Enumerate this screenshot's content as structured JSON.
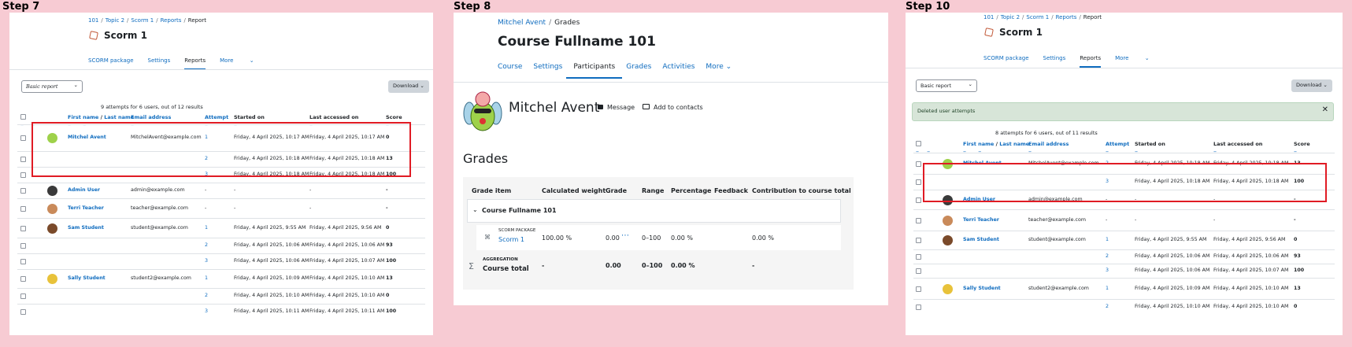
{
  "steps": [
    "Step 7",
    "Step 8",
    "Step 10"
  ],
  "scorm": {
    "breadcrumb": [
      "101",
      "Topic 2",
      "Scorm 1",
      "Reports",
      "Report"
    ],
    "title": "Scorm 1",
    "tabs": [
      "SCORM package",
      "Settings",
      "Reports",
      "More"
    ],
    "report_select": "Basic report",
    "download": "Download",
    "columns": {
      "first": "First name",
      "slash": "/",
      "last": "Last name",
      "email": "Email address",
      "attempt": "Attempt",
      "started": "Started on",
      "last_access": "Last accessed on",
      "score": "Score"
    },
    "step7": {
      "summary": "9 attempts for 6 users, out of 12 results",
      "rows": [
        {
          "name": "Mitchel Avent",
          "email": "MitchelAvent@example.com",
          "attempt": "1",
          "started": "Friday, 4 April 2025, 10:17 AM",
          "last": "Friday, 4 April 2025, 10:17 AM",
          "score": "0"
        },
        {
          "name": "",
          "email": "",
          "attempt": "2",
          "started": "Friday, 4 April 2025, 10:18 AM",
          "last": "Friday, 4 April 2025, 10:18 AM",
          "score": "13"
        },
        {
          "name": "",
          "email": "",
          "attempt": "3",
          "started": "Friday, 4 April 2025, 10:18 AM",
          "last": "Friday, 4 April 2025, 10:18 AM",
          "score": "100"
        },
        {
          "name": "Admin User",
          "email": "admin@example.com",
          "attempt": "-",
          "started": "-",
          "last": "-",
          "score": "-"
        },
        {
          "name": "Terri Teacher",
          "email": "teacher@example.com",
          "attempt": "-",
          "started": "-",
          "last": "-",
          "score": "-"
        },
        {
          "name": "Sam Student",
          "email": "student@example.com",
          "attempt": "1",
          "started": "Friday, 4 April 2025, 9:55 AM",
          "last": "Friday, 4 April 2025, 9:56 AM",
          "score": "0"
        },
        {
          "name": "",
          "email": "",
          "attempt": "2",
          "started": "Friday, 4 April 2025, 10:06 AM",
          "last": "Friday, 4 April 2025, 10:06 AM",
          "score": "93"
        },
        {
          "name": "",
          "email": "",
          "attempt": "3",
          "started": "Friday, 4 April 2025, 10:06 AM",
          "last": "Friday, 4 April 2025, 10:07 AM",
          "score": "100"
        },
        {
          "name": "Sally Student",
          "email": "student2@example.com",
          "attempt": "1",
          "started": "Friday, 4 April 2025, 10:09 AM",
          "last": "Friday, 4 April 2025, 10:10 AM",
          "score": "13"
        },
        {
          "name": "",
          "email": "",
          "attempt": "2",
          "started": "Friday, 4 April 2025, 10:10 AM",
          "last": "Friday, 4 April 2025, 10:10 AM",
          "score": "0"
        },
        {
          "name": "",
          "email": "",
          "attempt": "3",
          "started": "Friday, 4 April 2025, 10:11 AM",
          "last": "Friday, 4 April 2025, 10:11 AM",
          "score": "100"
        }
      ]
    },
    "step10": {
      "alert": "Deleted user attempts",
      "summary": "8 attempts for 6 users, out of 11 results",
      "rows": [
        {
          "name": "Mitchel Avent",
          "email": "MitchelAvent@example.com",
          "attempt": "2",
          "started": "Friday, 4 April 2025, 10:18 AM",
          "last": "Friday, 4 April 2025, 10:18 AM",
          "score": "13"
        },
        {
          "name": "",
          "email": "",
          "attempt": "3",
          "started": "Friday, 4 April 2025, 10:18 AM",
          "last": "Friday, 4 April 2025, 10:18 AM",
          "score": "100"
        },
        {
          "name": "Admin User",
          "email": "admin@example.com",
          "attempt": "-",
          "started": "-",
          "last": "-",
          "score": "-"
        },
        {
          "name": "Terri Teacher",
          "email": "teacher@example.com",
          "attempt": "-",
          "started": "-",
          "last": "-",
          "score": "-"
        },
        {
          "name": "Sam Student",
          "email": "student@example.com",
          "attempt": "1",
          "started": "Friday, 4 April 2025, 9:55 AM",
          "last": "Friday, 4 April 2025, 9:56 AM",
          "score": "0"
        },
        {
          "name": "",
          "email": "",
          "attempt": "2",
          "started": "Friday, 4 April 2025, 10:06 AM",
          "last": "Friday, 4 April 2025, 10:06 AM",
          "score": "93"
        },
        {
          "name": "",
          "email": "",
          "attempt": "3",
          "started": "Friday, 4 April 2025, 10:06 AM",
          "last": "Friday, 4 April 2025, 10:07 AM",
          "score": "100"
        },
        {
          "name": "Sally Student",
          "email": "student2@example.com",
          "attempt": "1",
          "started": "Friday, 4 April 2025, 10:09 AM",
          "last": "Friday, 4 April 2025, 10:10 AM",
          "score": "13"
        },
        {
          "name": "",
          "email": "",
          "attempt": "2",
          "started": "Friday, 4 April 2025, 10:10 AM",
          "last": "Friday, 4 April 2025, 10:10 AM",
          "score": "0"
        }
      ]
    }
  },
  "grades": {
    "breadcrumb": [
      "Mitchel Avent",
      "Grades"
    ],
    "course": "Course Fullname 101",
    "tabs": [
      "Course",
      "Settings",
      "Participants",
      "Grades",
      "Activities",
      "More"
    ],
    "user": "Mitchel Avent",
    "message": "Message",
    "contacts": "Add to contacts",
    "heading": "Grades",
    "cols": [
      "Grade item",
      "Calculated weight",
      "Grade",
      "Range",
      "Percentage",
      "Feedback",
      "Contribution to course total"
    ],
    "category": "Course Fullname 101",
    "item": {
      "type": "SCORM PACKAGE",
      "name": "Scorm 1",
      "weight": "100.00 %",
      "grade": "0.00",
      "range": "0–100",
      "pct": "0.00 %",
      "contrib": "0.00 %"
    },
    "total": {
      "type": "AGGREGATION",
      "name": "Course total",
      "weight": "-",
      "grade": "0.00",
      "range": "0–100",
      "pct": "0.00 %",
      "contrib": "-"
    }
  }
}
